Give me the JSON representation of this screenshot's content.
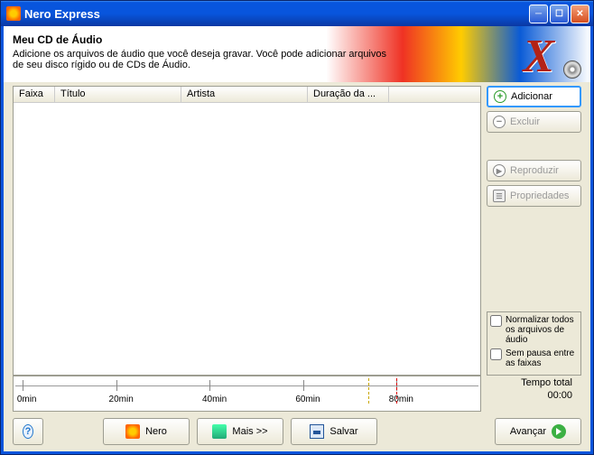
{
  "window": {
    "title": "Nero Express"
  },
  "header": {
    "title": "Meu CD de Áudio",
    "description": "Adicione os arquivos de áudio que você deseja gravar. Você pode adicionar arquivos de seu disco rígido ou de CDs de Áudio."
  },
  "columns": {
    "track": "Faixa",
    "title": "Título",
    "artist": "Artista",
    "duration": "Duração da ..."
  },
  "side_buttons": {
    "add": "Adicionar",
    "delete": "Excluir",
    "play": "Reproduzir",
    "properties": "Propriedades"
  },
  "options": {
    "normalize": "Normalizar todos os arquivos de áudio",
    "nogap": "Sem pausa entre as faixas"
  },
  "timeline": {
    "t0": "0min",
    "t20": "20min",
    "t40": "40min",
    "t60": "60min",
    "t80": "80min"
  },
  "totals": {
    "label": "Tempo total",
    "value": "00:00"
  },
  "bottom": {
    "nero": "Nero",
    "more": "Mais >>",
    "save": "Salvar",
    "next": "Avançar"
  }
}
